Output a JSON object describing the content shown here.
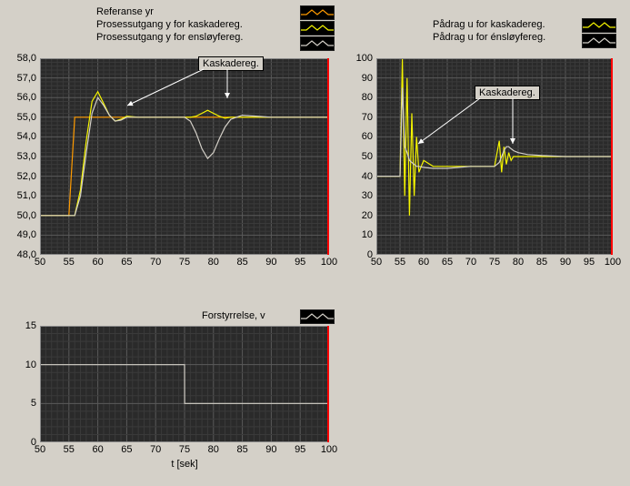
{
  "legends": {
    "chart1": [
      {
        "label": "Referanse yr",
        "color": "#ff9b00"
      },
      {
        "label": "Prosessutgang y for kaskadereg.",
        "color": "#f5f500"
      },
      {
        "label": "Prosessutgang y for ensløyfereg.",
        "color": "#d4d0c8"
      }
    ],
    "chart2": [
      {
        "label": "Pådrag u for kaskadereg.",
        "color": "#f5f500"
      },
      {
        "label": "Pådrag u for énsløyfereg.",
        "color": "#d4d0c8"
      }
    ],
    "chart3": [
      {
        "label": "Forstyrrelse, v",
        "color": "#d4d0c8"
      }
    ]
  },
  "axis": {
    "x_label": "t [sek]",
    "chart1": {
      "x": [
        50,
        100
      ],
      "y": [
        48,
        58
      ],
      "xticks": [
        50,
        55,
        60,
        65,
        70,
        75,
        80,
        85,
        90,
        95,
        100
      ],
      "yticks": [
        48,
        49,
        50,
        51,
        52,
        53,
        54,
        55,
        56,
        57,
        58
      ]
    },
    "chart2": {
      "x": [
        50,
        100
      ],
      "y": [
        0,
        100
      ],
      "xticks": [
        50,
        55,
        60,
        65,
        70,
        75,
        80,
        85,
        90,
        95,
        100
      ],
      "yticks": [
        0,
        10,
        20,
        30,
        40,
        50,
        60,
        70,
        80,
        90,
        100
      ]
    },
    "chart3": {
      "x": [
        50,
        100
      ],
      "y": [
        0,
        15
      ],
      "xticks": [
        50,
        55,
        60,
        65,
        70,
        75,
        80,
        85,
        90,
        95,
        100
      ],
      "yticks": [
        0,
        5,
        10,
        15
      ]
    }
  },
  "annotations": {
    "chart1": {
      "text": "Kaskadereg."
    },
    "chart2": {
      "text": "Kaskadereg."
    }
  },
  "chart_data": [
    {
      "id": "chart1",
      "type": "line",
      "title": "",
      "xlabel": "t [sek]",
      "ylabel": "",
      "xlim": [
        50,
        100
      ],
      "ylim": [
        48,
        58
      ],
      "x": [
        50,
        55,
        56,
        57,
        58,
        59,
        60,
        61,
        62,
        63,
        64,
        65,
        67,
        70,
        75,
        76,
        77,
        78,
        79,
        80,
        81,
        82,
        83,
        85,
        90,
        95,
        100
      ],
      "series": [
        {
          "name": "Referanse yr",
          "color": "#ff9b00",
          "values": [
            50,
            50,
            55,
            55,
            55,
            55,
            55,
            55,
            55,
            55,
            55,
            55,
            55,
            55,
            55,
            55,
            55,
            55,
            55,
            55,
            55,
            55,
            55,
            55,
            55,
            55,
            55
          ]
        },
        {
          "name": "Prosessutgang y for kaskadereg.",
          "color": "#f5f500",
          "values": [
            50,
            50,
            50,
            51.3,
            53.8,
            55.8,
            56.3,
            55.7,
            55.1,
            54.8,
            54.9,
            55.05,
            55.0,
            55.0,
            55.0,
            55.0,
            55.05,
            55.2,
            55.35,
            55.2,
            55.05,
            54.95,
            55.0,
            55.0,
            55.0,
            55.0,
            55.0
          ]
        },
        {
          "name": "Prosessutgang y for ensløyfereg.",
          "color": "#d4d0c8",
          "values": [
            50,
            50,
            50,
            51.0,
            53.2,
            55.2,
            56.0,
            55.6,
            55.1,
            54.8,
            54.85,
            55.0,
            55.0,
            55.0,
            55.0,
            54.8,
            54.2,
            53.4,
            52.9,
            53.2,
            53.9,
            54.5,
            54.9,
            55.1,
            55.0,
            55.0,
            55.0
          ]
        }
      ],
      "annotation": "Kaskadereg."
    },
    {
      "id": "chart2",
      "type": "line",
      "title": "",
      "xlabel": "t [sek]",
      "ylabel": "",
      "xlim": [
        50,
        100
      ],
      "ylim": [
        0,
        100
      ],
      "x": [
        50,
        55,
        55.5,
        56,
        56.5,
        57,
        57.5,
        58,
        58.5,
        59,
        60,
        62,
        65,
        70,
        75,
        76,
        76.5,
        77,
        77.5,
        78,
        78.5,
        79,
        80,
        82,
        85,
        90,
        95,
        100
      ],
      "series": [
        {
          "name": "Pådrag u for kaskadereg.",
          "color": "#f5f500",
          "values": [
            40,
            40,
            100,
            30,
            90,
            20,
            72,
            30,
            60,
            42,
            48,
            45,
            45,
            45,
            45,
            58,
            42,
            55,
            46,
            52,
            48,
            50,
            50,
            50,
            50,
            50,
            50,
            50
          ]
        },
        {
          "name": "Pådrag u for énsløyfereg.",
          "color": "#d4d0c8",
          "values": [
            40,
            40,
            85,
            55,
            52,
            48,
            47,
            46,
            45,
            45,
            44.5,
            44,
            44,
            45,
            45,
            47,
            50,
            53,
            55,
            55,
            54,
            53,
            52,
            51,
            50.5,
            50,
            50,
            50
          ]
        }
      ],
      "annotation": "Kaskadereg."
    },
    {
      "id": "chart3",
      "type": "line",
      "title": "",
      "xlabel": "t [sek]",
      "ylabel": "",
      "xlim": [
        50,
        100
      ],
      "ylim": [
        0,
        15
      ],
      "x": [
        50,
        75,
        75.01,
        100
      ],
      "series": [
        {
          "name": "Forstyrrelse, v",
          "color": "#d4d0c8",
          "values": [
            10,
            10,
            5,
            5
          ]
        }
      ]
    }
  ]
}
